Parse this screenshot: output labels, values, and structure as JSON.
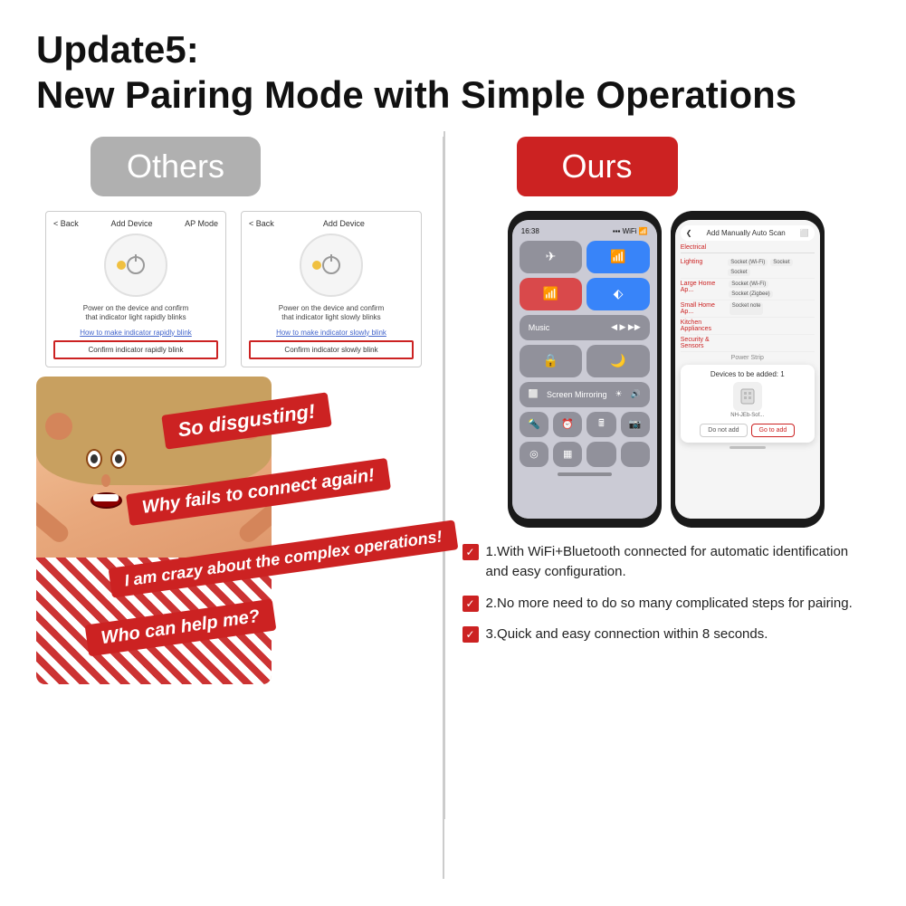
{
  "title": {
    "line1": "Update5:",
    "line2": "New Pairing Mode with Simple Operations"
  },
  "left": {
    "badge": "Others",
    "device_screens": [
      {
        "header_left": "< Back",
        "header_mid": "Add Device",
        "header_right": "AP Mode",
        "text1": "Power on the device and confirm",
        "text2": "that indicator light rapidly blinks",
        "link": "How to make indicator rapidly blink",
        "btn": "Confirm indicator rapidly blink"
      },
      {
        "header_left": "< Back",
        "header_mid": "Add Device",
        "header_right": "",
        "text1": "Power on the device and confirm",
        "text2": "that indicator light slowly blinks",
        "link": "How to make indicator slowly blink",
        "btn": "Confirm indicator slowly blink"
      }
    ],
    "slogans": [
      "So disgusting!",
      "Why fails to connect again!",
      "I am crazy about the complex operations!",
      "Who can help me?"
    ]
  },
  "right": {
    "badge": "Ours",
    "phone_left": {
      "status_time": "16:38",
      "control_center_label": "Control Center"
    },
    "phone_right": {
      "header": "Add Manually  Auto Scan",
      "categories": [
        {
          "label": "Electrical",
          "options": [
            "Socket"
          ]
        },
        {
          "label": "Lighting",
          "options": [
            "Socket (Wi-Fi)",
            "Socket",
            "Socket"
          ]
        },
        {
          "label": "Large Home Ap...",
          "options": [
            "Socket (Wi-Fi)",
            "Socket (Zigbee)"
          ]
        },
        {
          "label": "Small Home Ap...",
          "options": [
            "Socket note"
          ]
        },
        {
          "label": "Kitchen Appliances",
          "options": []
        },
        {
          "label": "Security & Sensors",
          "options": []
        }
      ],
      "power_strip": "Power Strip",
      "popup_title": "Devices to be added: 1",
      "popup_device_name": "NH-JEb-Sof...",
      "btn_no": "Do not add",
      "btn_yes": "Go to add"
    },
    "features": [
      {
        "number": "1",
        "text": "1.With WiFi+Bluetooth connected for automatic identification and easy configuration."
      },
      {
        "number": "2",
        "text": "2.No more need to do so many complicated steps for pairing."
      },
      {
        "number": "3",
        "text": "3.Quick and easy connection within 8 seconds."
      }
    ]
  },
  "colors": {
    "red": "#cc2222",
    "gray_badge": "#b0b0b0",
    "text_dark": "#111111"
  }
}
